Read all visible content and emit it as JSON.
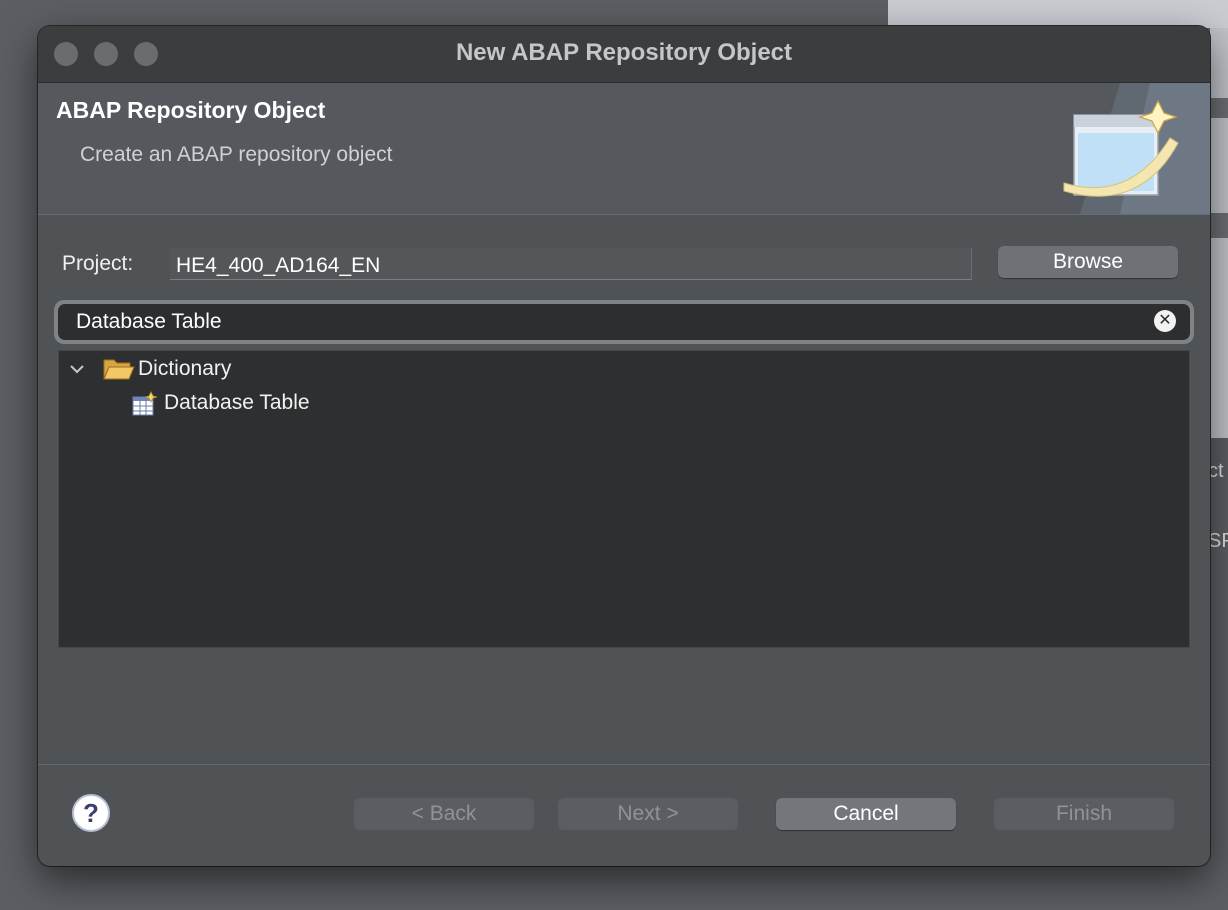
{
  "window": {
    "title": "New ABAP Repository Object"
  },
  "header": {
    "title": "ABAP Repository Object",
    "subtitle": "Create an ABAP repository object"
  },
  "project": {
    "label": "Project:",
    "value": "HE4_400_AD164_EN",
    "browse_label": "Browse"
  },
  "filter": {
    "value": "Database Table"
  },
  "tree": {
    "items": [
      {
        "label": "Dictionary",
        "expanded": true,
        "icon": "folder-open-icon"
      },
      {
        "label": "Database Table",
        "icon": "database-table-icon"
      }
    ]
  },
  "footer": {
    "back_label": "< Back",
    "next_label": "Next >",
    "cancel_label": "Cancel",
    "finish_label": "Finish",
    "help_glyph": "?"
  },
  "background": {
    "text_1": "ct",
    "text_2": "SP"
  },
  "colors": {
    "window_bg": "#4f5356",
    "tree_bg": "#2e2f30",
    "accent_focus": "#7e8388"
  }
}
